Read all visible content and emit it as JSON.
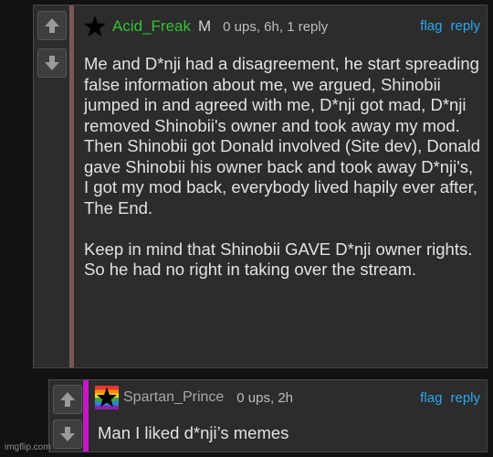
{
  "comments": [
    {
      "username": "Acid_Freak",
      "role": "M",
      "meta": "0 ups, 6h, 1 reply",
      "flag_label": "flag",
      "reply_label": "reply",
      "body": "Me and D*nji had a disagreement, he start spreading false information about me, we argued, Shinobii jumped in and agreed with me, D*nji got mad, D*nji removed Shinobii's owner and took away my mod. Then Shinobii got Donald involved (Site dev), Donald gave Shinobii his owner back and took away D*nji's, I got my mod back, everybody lived hapily ever after, The End.\n\nKeep in mind that Shinobii GAVE D*nji owner rights. So he had no right in taking over the stream.",
      "stripe_color": "#7a5757",
      "avatar_icon": "black-star-icon"
    },
    {
      "username": "Spartan_Prince",
      "meta": "0 ups, 2h",
      "flag_label": "flag",
      "reply_label": "reply",
      "body": "Man I liked d*nji’s memes",
      "stripe_color": "#c517c5",
      "avatar_icon": "rainbow-star-avatar"
    }
  ],
  "watermark": "imgflip.com",
  "colors": {
    "background": "#121212",
    "card": "#2c2c2c",
    "link": "#2aa8f0",
    "mod_username": "#35c235"
  }
}
